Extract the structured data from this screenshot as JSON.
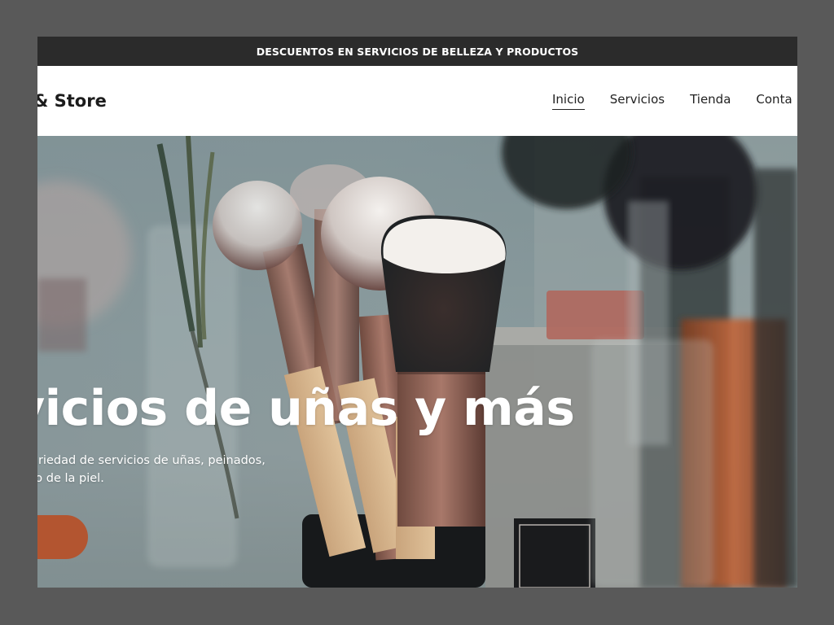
{
  "announcement": {
    "text": "DESCUENTOS EN SERVICIOS DE BELLEZA Y PRODUCTOS"
  },
  "header": {
    "brand": "& Store",
    "nav": [
      {
        "label": "Inicio",
        "active": true
      },
      {
        "label": "Servicios",
        "active": false
      },
      {
        "label": "Tienda",
        "active": false
      },
      {
        "label": "Conta",
        "active": false
      }
    ]
  },
  "hero": {
    "title": "vicios de uñas y más",
    "subtitle_lines": [
      "a variedad de servicios de uñas, peinados,",
      "dado de la piel."
    ],
    "cta_label": "",
    "background_image": "makeup-brushes-photo"
  },
  "colors": {
    "announcement_bg": "#2b2b2b",
    "cta": "#b35530",
    "text_dark": "#222222",
    "page_bg": "#595959"
  }
}
